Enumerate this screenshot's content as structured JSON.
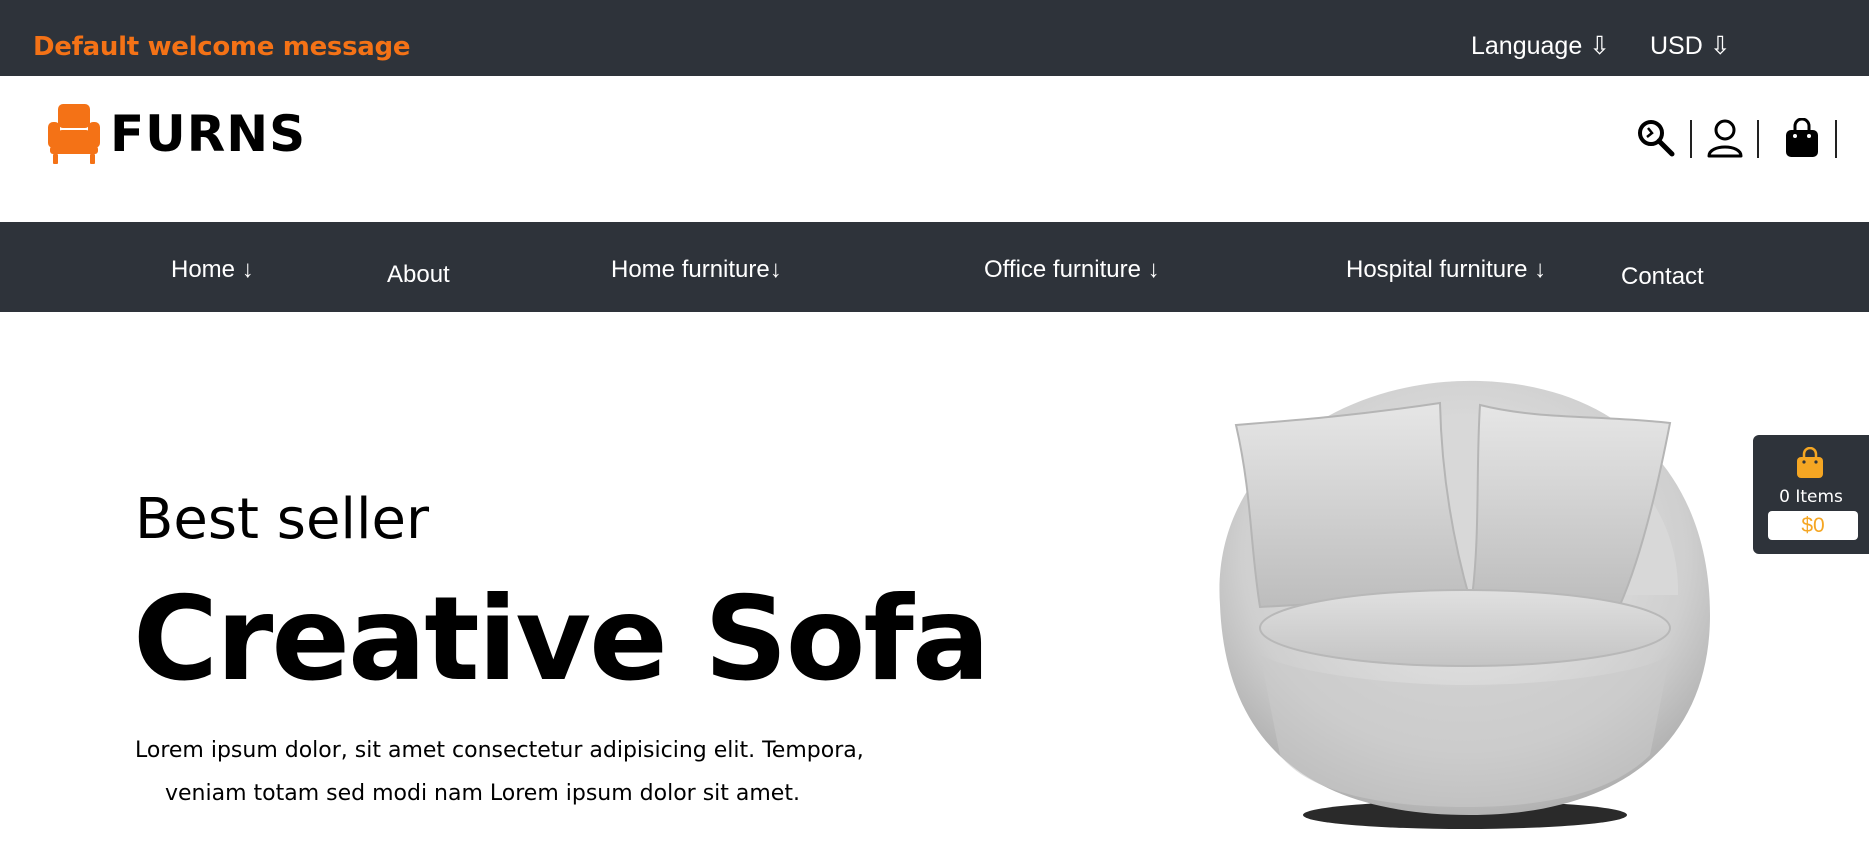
{
  "topbar": {
    "welcome": "Default welcome message",
    "language": "Language ⇩",
    "currency": "USD ⇩"
  },
  "header": {
    "logo_text": "FURNS",
    "icons": [
      "search-icon",
      "user-icon",
      "shopping-bag-icon"
    ]
  },
  "nav": {
    "items": [
      {
        "label": "Home ↓"
      },
      {
        "label": "About"
      },
      {
        "label": "Home furniture↓"
      },
      {
        "label": "Office furniture ↓"
      },
      {
        "label": "Hospital furniture ↓"
      },
      {
        "label": "Contact"
      }
    ]
  },
  "hero": {
    "subtitle": "Best seller",
    "title": "Creative Sofa",
    "description_line1": "Lorem ipsum dolor, sit amet consectetur adipisicing elit. Tempora,",
    "description_line2": "veniam totam sed modi nam Lorem ipsum dolor sit amet."
  },
  "minicart": {
    "count": "0 Items",
    "total": "$0"
  },
  "colors": {
    "dark_bar": "#2e333a",
    "accent_orange": "#f47216",
    "cart_gold": "#f5a623"
  }
}
